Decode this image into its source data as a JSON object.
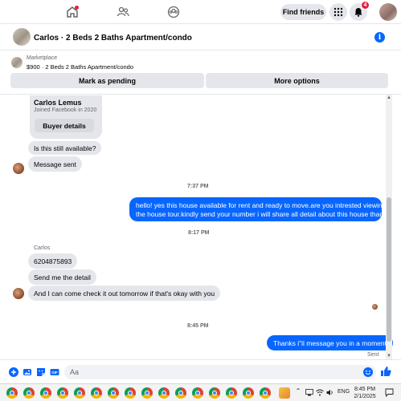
{
  "topnav": {
    "find_friends_label": "Find friends",
    "notification_count": "4"
  },
  "chat_header": {
    "title": "Carlos · 2 Beds 2 Baths Apartment/condo"
  },
  "marketplace": {
    "label": "Marketplace",
    "listing": "$900 · 2 Beds 2 Baths Apartment/condo",
    "mark_pending_label": "Mark as pending",
    "more_options_label": "More options"
  },
  "profile_card": {
    "name": "Carlos Lemus",
    "joined": "Joined Facebook in 2020",
    "buyer_details_label": "Buyer details"
  },
  "messages": {
    "m1": "Is this still available?",
    "m2": "Message sent",
    "ts1": "7:37 PM",
    "m3_line1": "hello! yes this house available for rent and ready to move.are you intrested viewing",
    "m3_line2": "the house tour.kindly send your number i will share all detail about this house thanks.",
    "ts2": "8:17 PM",
    "sender": "Carlos",
    "m4": "6204875893",
    "m5": "Send me the detail",
    "m6": "And I can come check it out tomorrow if that's okay with you",
    "ts3": "8:45 PM",
    "m7": "Thanks i\"il message you in a moment",
    "status": "Sent"
  },
  "composer": {
    "placeholder": "Aa"
  },
  "taskbar": {
    "language": "ENG",
    "time": "8:45 PM",
    "date": "2/1/2025"
  },
  "colors": {
    "accent": "#0866ff",
    "bubble_gray": "#e4e6eb",
    "badge_red": "#e41e3f"
  }
}
